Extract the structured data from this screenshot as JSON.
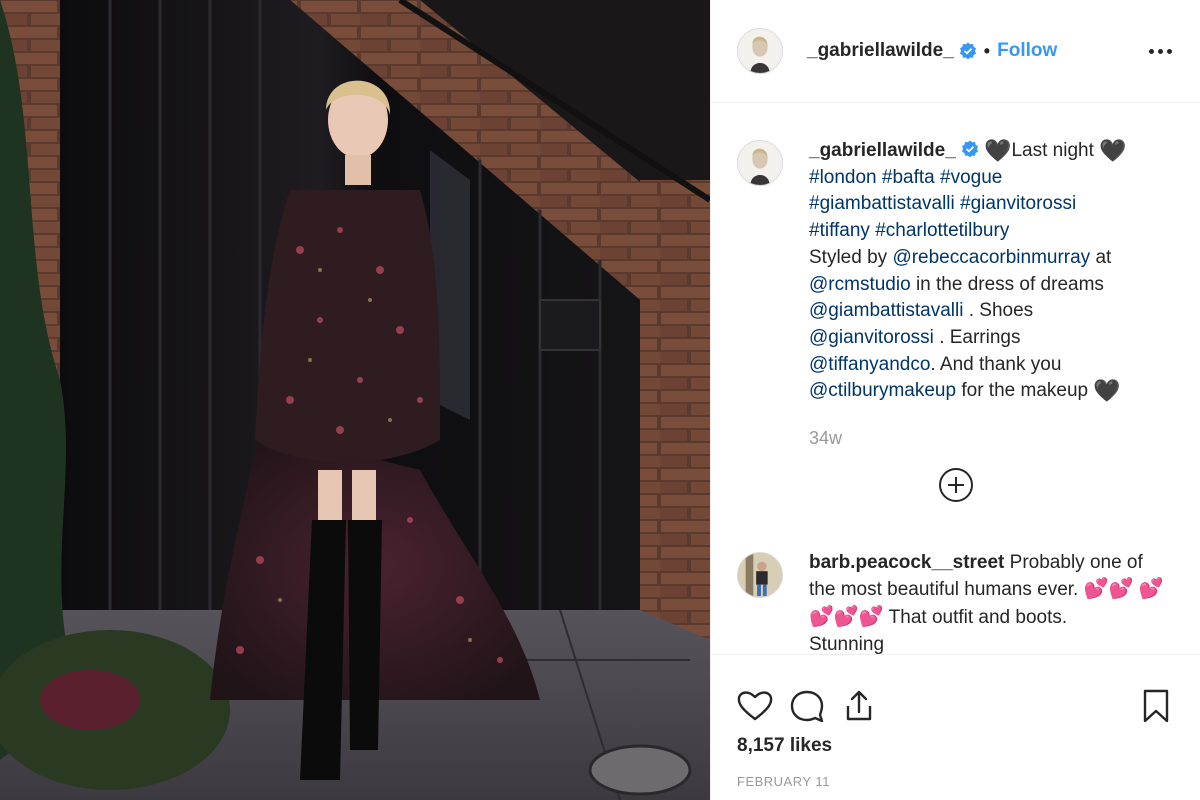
{
  "post": {
    "username": "_gabriellawilde_",
    "follow_label": "Follow",
    "separator": "•"
  },
  "caption": {
    "username": "_gabriellawilde_",
    "heart": "🖤",
    "line1": "Last night",
    "tags1": "#london #bafta #vogue",
    "tags2": "#giambattistavalli #gianvitorossi",
    "tags3": "#tiffany #charlottetilbury",
    "styled_by": "Styled by",
    "mention_stylist": "@rebeccacorbinmurray",
    "at": "at",
    "mention_studio": "@rcmstudio",
    "dress_text": "in the dress of dreams",
    "mention_dress": "@giambattistavalli",
    "shoes_text": ". Shoes",
    "mention_shoes": "@gianvitorossi",
    "earrings_text": ". Earrings",
    "mention_earrings": "@tiffanyandco",
    "thank_text": ". And thank you",
    "mention_makeup": "@ctilburymakeup",
    "makeup_text": "for the makeup",
    "time_ago": "34w"
  },
  "comment": {
    "username": "barb.peacock__street",
    "text1": "Probably one of the most beautiful humans ever.",
    "emoji": "💕",
    "text2": "That outfit and boots.",
    "text3": "Stunning"
  },
  "footer": {
    "likes": "8,157 likes",
    "date": "FEBRUARY 11"
  },
  "icons": [
    "verified-badge-icon",
    "more-options-icon",
    "load-more-plus-icon",
    "heart-icon",
    "comment-icon",
    "share-icon",
    "bookmark-icon"
  ],
  "colors": {
    "accent": "#3897f0",
    "link": "#003569",
    "text": "#262626",
    "muted": "#999999",
    "border": "#efefef"
  }
}
